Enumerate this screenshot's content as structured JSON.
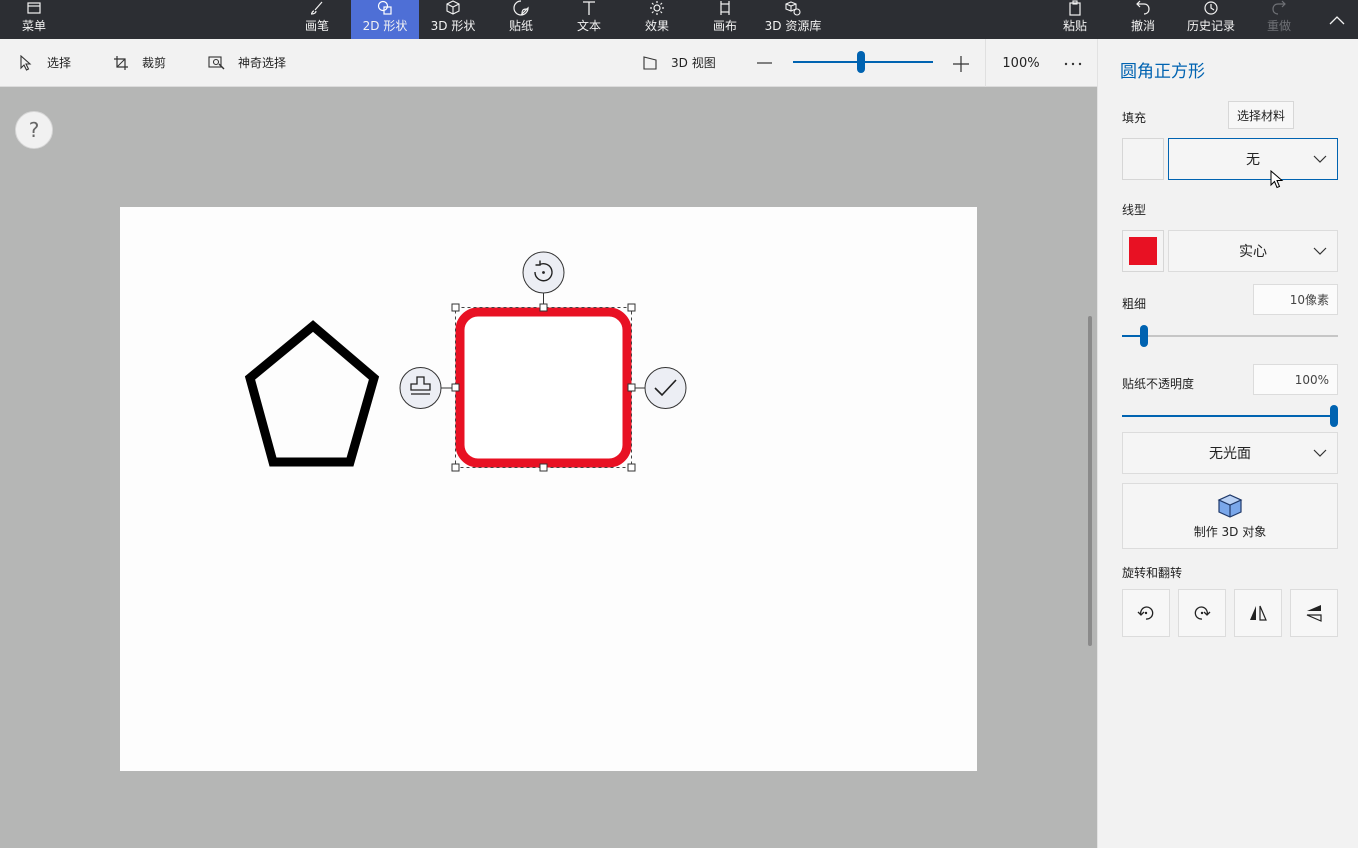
{
  "menu": {
    "label": "菜单"
  },
  "tools": [
    {
      "label": "画笔",
      "icon": "brush-icon"
    },
    {
      "label": "2D 形状",
      "icon": "2d-shapes-icon",
      "active": true
    },
    {
      "label": "3D 形状",
      "icon": "3d-shapes-icon"
    },
    {
      "label": "贴纸",
      "icon": "sticker-icon"
    },
    {
      "label": "文本",
      "icon": "text-icon"
    },
    {
      "label": "效果",
      "icon": "effects-icon"
    },
    {
      "label": "画布",
      "icon": "canvas-icon"
    },
    {
      "label": "3D 资源库",
      "icon": "3d-library-icon"
    }
  ],
  "actions": {
    "paste": "粘贴",
    "undo": "撤消",
    "history": "历史记录",
    "redo": "重做"
  },
  "toolbar": {
    "select": "选择",
    "crop": "裁剪",
    "magic_select": "神奇选择",
    "view3d": "3D 视图",
    "zoom_percent": "100%",
    "zoom_level": 0.5
  },
  "panel": {
    "title": "圆角正方形",
    "fill_label": "填充",
    "choose_material": "选择材料",
    "fill_value": "无",
    "line_label": "线型",
    "line_color": "#e81123",
    "line_value": "实心",
    "thickness_label": "粗细",
    "thickness_value": "10像素",
    "thickness_level": 0.1,
    "opacity_label": "贴纸不透明度",
    "opacity_value": "100%",
    "opacity_level": 1.0,
    "finish_value": "无光面",
    "make3d": "制作 3D 对象",
    "rotate_label": "旋转和翻转"
  },
  "colors": {
    "accent": "#0063b1",
    "shape_stroke": "#e81123",
    "active_tab": "#4e6fd6",
    "topbar": "#2c2e33"
  }
}
